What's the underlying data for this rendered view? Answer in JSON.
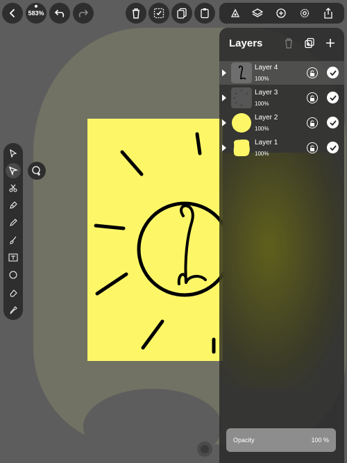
{
  "toolbar": {
    "zoom": "583%",
    "icons": [
      "back-icon",
      "undo-icon",
      "redo-icon",
      "trash-icon",
      "select-all-icon",
      "duplicate-icon",
      "paste-icon",
      "brush-settings-icon",
      "layers-icon",
      "add-icon",
      "settings-icon",
      "share-icon"
    ]
  },
  "tools": [
    "arrow-select",
    "direct-select",
    "scissors",
    "pen",
    "pencil",
    "brush",
    "text",
    "shape",
    "eraser",
    "eyedropper"
  ],
  "panel": {
    "title": "Layers",
    "layers": [
      {
        "name": "Layer 4",
        "opacity": "100%",
        "selected": true
      },
      {
        "name": "Layer 3",
        "opacity": "100%",
        "selected": false
      },
      {
        "name": "Layer 2",
        "opacity": "100%",
        "selected": false
      },
      {
        "name": "Layer 1",
        "opacity": "100%",
        "selected": false
      }
    ],
    "opacity_label": "Opacity",
    "opacity_value": "100 %"
  },
  "colors": {
    "canvas": "#fdf768",
    "ink": "#000000",
    "panel": "#2a2a2a"
  }
}
